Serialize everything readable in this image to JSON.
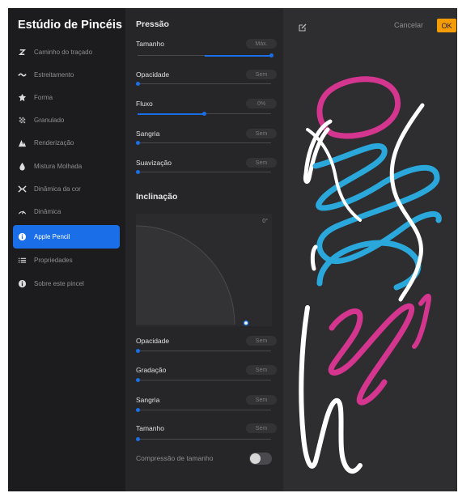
{
  "sidebar": {
    "title": "Estúdio de Pincéis",
    "items": [
      {
        "label": "Caminho do traçado",
        "icon": "stroke-path-icon",
        "active": false
      },
      {
        "label": "Estreitamento",
        "icon": "taper-icon",
        "active": false
      },
      {
        "label": "Forma",
        "icon": "shape-icon",
        "active": false
      },
      {
        "label": "Granulado",
        "icon": "grain-icon",
        "active": false
      },
      {
        "label": "Renderização",
        "icon": "rendering-icon",
        "active": false
      },
      {
        "label": "Mistura Molhada",
        "icon": "wet-mix-icon",
        "active": false
      },
      {
        "label": "Dinâmica da cor",
        "icon": "color-dynamics-icon",
        "active": false
      },
      {
        "label": "Dinâmica",
        "icon": "dynamics-icon",
        "active": false
      },
      {
        "label": "Apple Pencil",
        "icon": "apple-pencil-icon",
        "active": true
      },
      {
        "label": "Propriedades",
        "icon": "properties-icon",
        "active": false
      },
      {
        "label": "Sobre este pincel",
        "icon": "info-icon",
        "active": false
      }
    ]
  },
  "pressure": {
    "title": "Pressão",
    "rows": [
      {
        "label": "Tamanho",
        "value": "Máx.",
        "level": 1.0
      },
      {
        "label": "Opacidade",
        "value": "Sem",
        "level": 0.0
      },
      {
        "label": "Fluxo",
        "value": "0%",
        "level": 0.5
      },
      {
        "label": "Sangria",
        "value": "Sem",
        "level": 0.0
      },
      {
        "label": "Suavização",
        "value": "Sem",
        "level": 0.0
      }
    ]
  },
  "tilt": {
    "title": "Inclinação",
    "angle": "0°",
    "rows": [
      {
        "label": "Opacidade",
        "value": "Sem",
        "level": 0.0
      },
      {
        "label": "Gradação",
        "value": "Sem",
        "level": 0.0
      },
      {
        "label": "Sangria",
        "value": "Sem",
        "level": 0.0
      },
      {
        "label": "Tamanho",
        "value": "Sem",
        "level": 0.0
      }
    ],
    "size_compression": {
      "label": "Compressão de tamanho",
      "on": false
    }
  },
  "header": {
    "cancel_label": "Cancelar",
    "ok_label": "OK"
  },
  "colors": {
    "accent": "#1a6ee8",
    "ok": "#f49c05",
    "stroke_magenta": "#d4358f",
    "stroke_cyan": "#2aa8dc",
    "stroke_white": "#ffffff"
  }
}
